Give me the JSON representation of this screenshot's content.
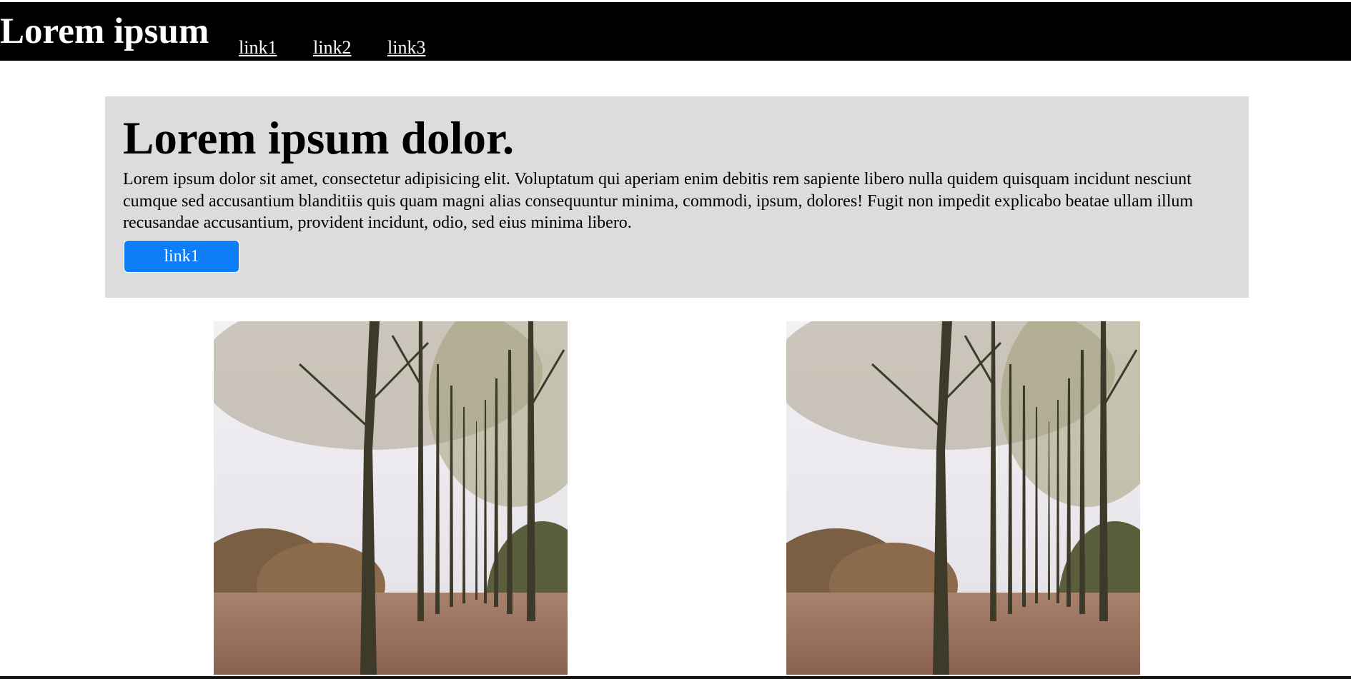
{
  "header": {
    "brand": "Lorem ipsum",
    "links": [
      "link1",
      "link2",
      "link3"
    ]
  },
  "hero": {
    "title": "Lorem ipsum dolor.",
    "text": "Lorem ipsum dolor sit amet, consectetur adipisicing elit. Voluptatum qui aperiam enim debitis rem sapiente libero nulla quidem quisquam incidunt nesciunt cumque sed accusantium blanditiis quis quam magni alias consequuntur minima, commodi, ipsum, dolores! Fugit non impedit explicabo beatae ullam illum recusandae accusantium, provident incidunt, odio, sed eius minima libero.",
    "button_label": "link1",
    "button_color": "#0d7ef7",
    "background_color": "#dddcdd"
  },
  "gallery": {
    "images": [
      {
        "subject": "autumn-forest-avenue"
      },
      {
        "subject": "autumn-forest-avenue"
      }
    ]
  }
}
